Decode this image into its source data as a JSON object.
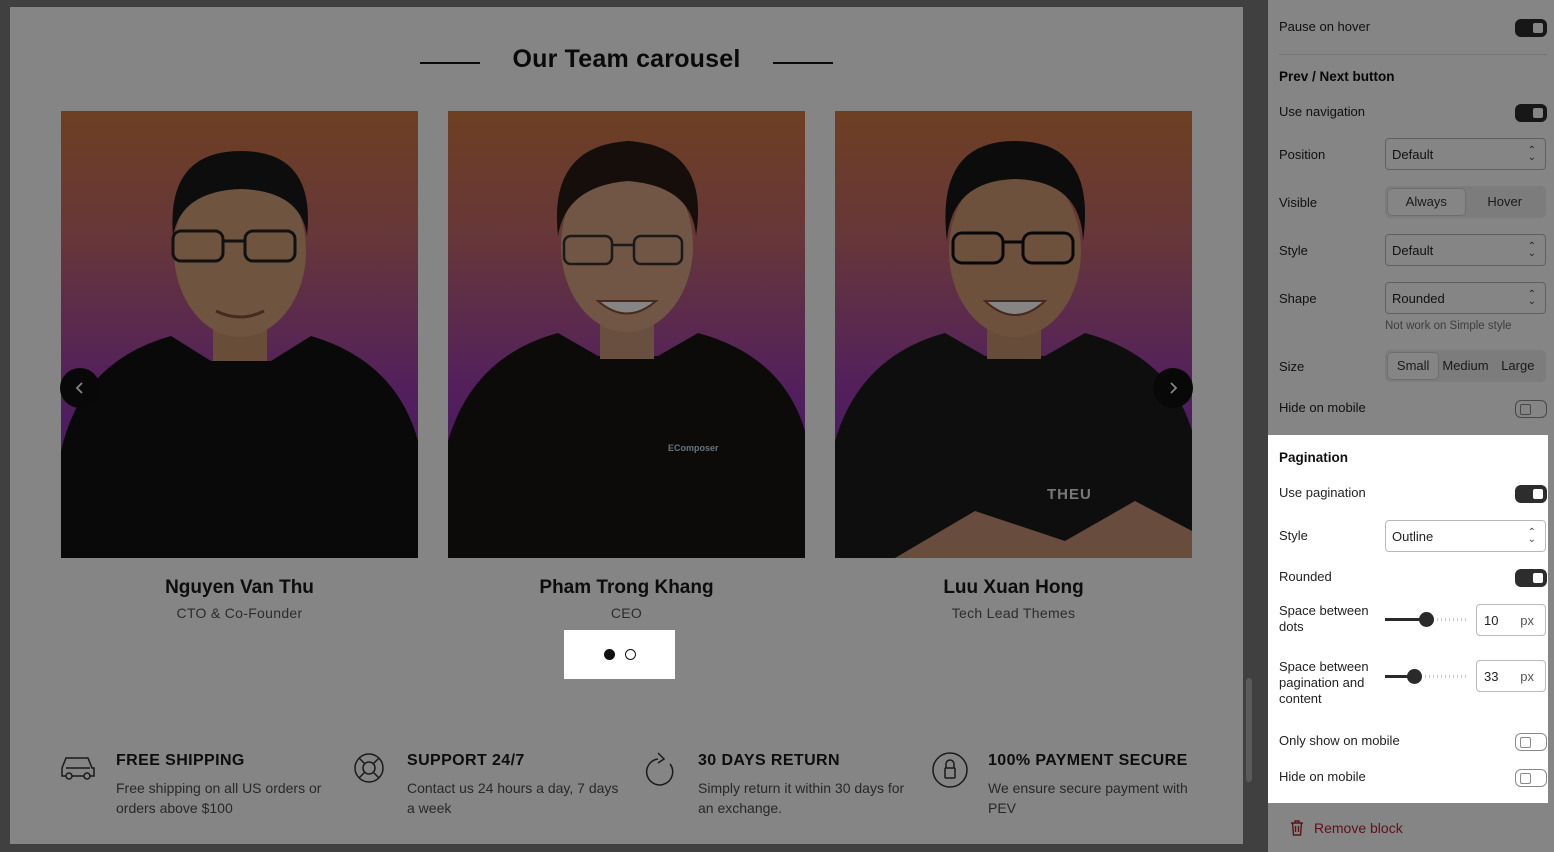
{
  "canvas": {
    "title": "Our Team carousel",
    "members": [
      {
        "name": "Nguyen Van Thu",
        "role": "CTO & Co-Founder"
      },
      {
        "name": "Pham Trong Khang",
        "role": "CEO",
        "shirt_logo": "EComposer"
      },
      {
        "name": "Luu Xuan Hong",
        "role": "Tech Lead Themes",
        "shirt_logo": "THEU"
      }
    ],
    "pagination": {
      "total": 2,
      "active": 1
    },
    "features": [
      {
        "icon": "truck-icon",
        "title": "FREE SHIPPING",
        "desc": "Free shipping on all US orders or orders above $100"
      },
      {
        "icon": "lifebuoy-icon",
        "title": "SUPPORT 24/7",
        "desc": "Contact us 24 hours a day, 7 days a week"
      },
      {
        "icon": "refresh-icon",
        "title": "30 DAYS RETURN",
        "desc": "Simply return it within 30 days for an exchange."
      },
      {
        "icon": "secure-shield-icon",
        "title": "100% PAYMENT SECURE",
        "desc": "We ensure secure payment with PEV"
      }
    ]
  },
  "panel": {
    "pause_on_hover": {
      "label": "Pause on hover",
      "on": true
    },
    "nav_section": "Prev / Next button",
    "use_navigation": {
      "label": "Use navigation",
      "on": true
    },
    "position": {
      "label": "Position",
      "value": "Default"
    },
    "visible": {
      "label": "Visible",
      "options": [
        "Always",
        "Hover"
      ],
      "selected": "Always"
    },
    "style": {
      "label": "Style",
      "value": "Default"
    },
    "shape": {
      "label": "Shape",
      "value": "Rounded",
      "hint": "Not work on Simple style"
    },
    "size": {
      "label": "Size",
      "options": [
        "Small",
        "Medium",
        "Large"
      ],
      "selected": "Small"
    },
    "nav_hide_mobile": {
      "label": "Hide on mobile",
      "on": false
    },
    "pagination_section": "Pagination",
    "use_pagination": {
      "label": "Use pagination",
      "on": true
    },
    "pag_style": {
      "label": "Style",
      "value": "Outline"
    },
    "rounded": {
      "label": "Rounded",
      "on": true
    },
    "space_dots": {
      "label": "Space between dots",
      "value": "10",
      "unit": "px",
      "level": 0.5
    },
    "space_content": {
      "label": "Space between pagination and content",
      "value": "33",
      "unit": "px",
      "level": 0.35
    },
    "only_mobile": {
      "label": "Only show on mobile",
      "on": false
    },
    "pag_hide_mobile": {
      "label": "Hide on mobile",
      "on": false
    },
    "remove_block": "Remove block"
  },
  "colors": {
    "accent": "#2d2d2d",
    "danger": "#b3262f",
    "photo_top": "#d27a42",
    "photo_bottom": "#7b22c4"
  }
}
